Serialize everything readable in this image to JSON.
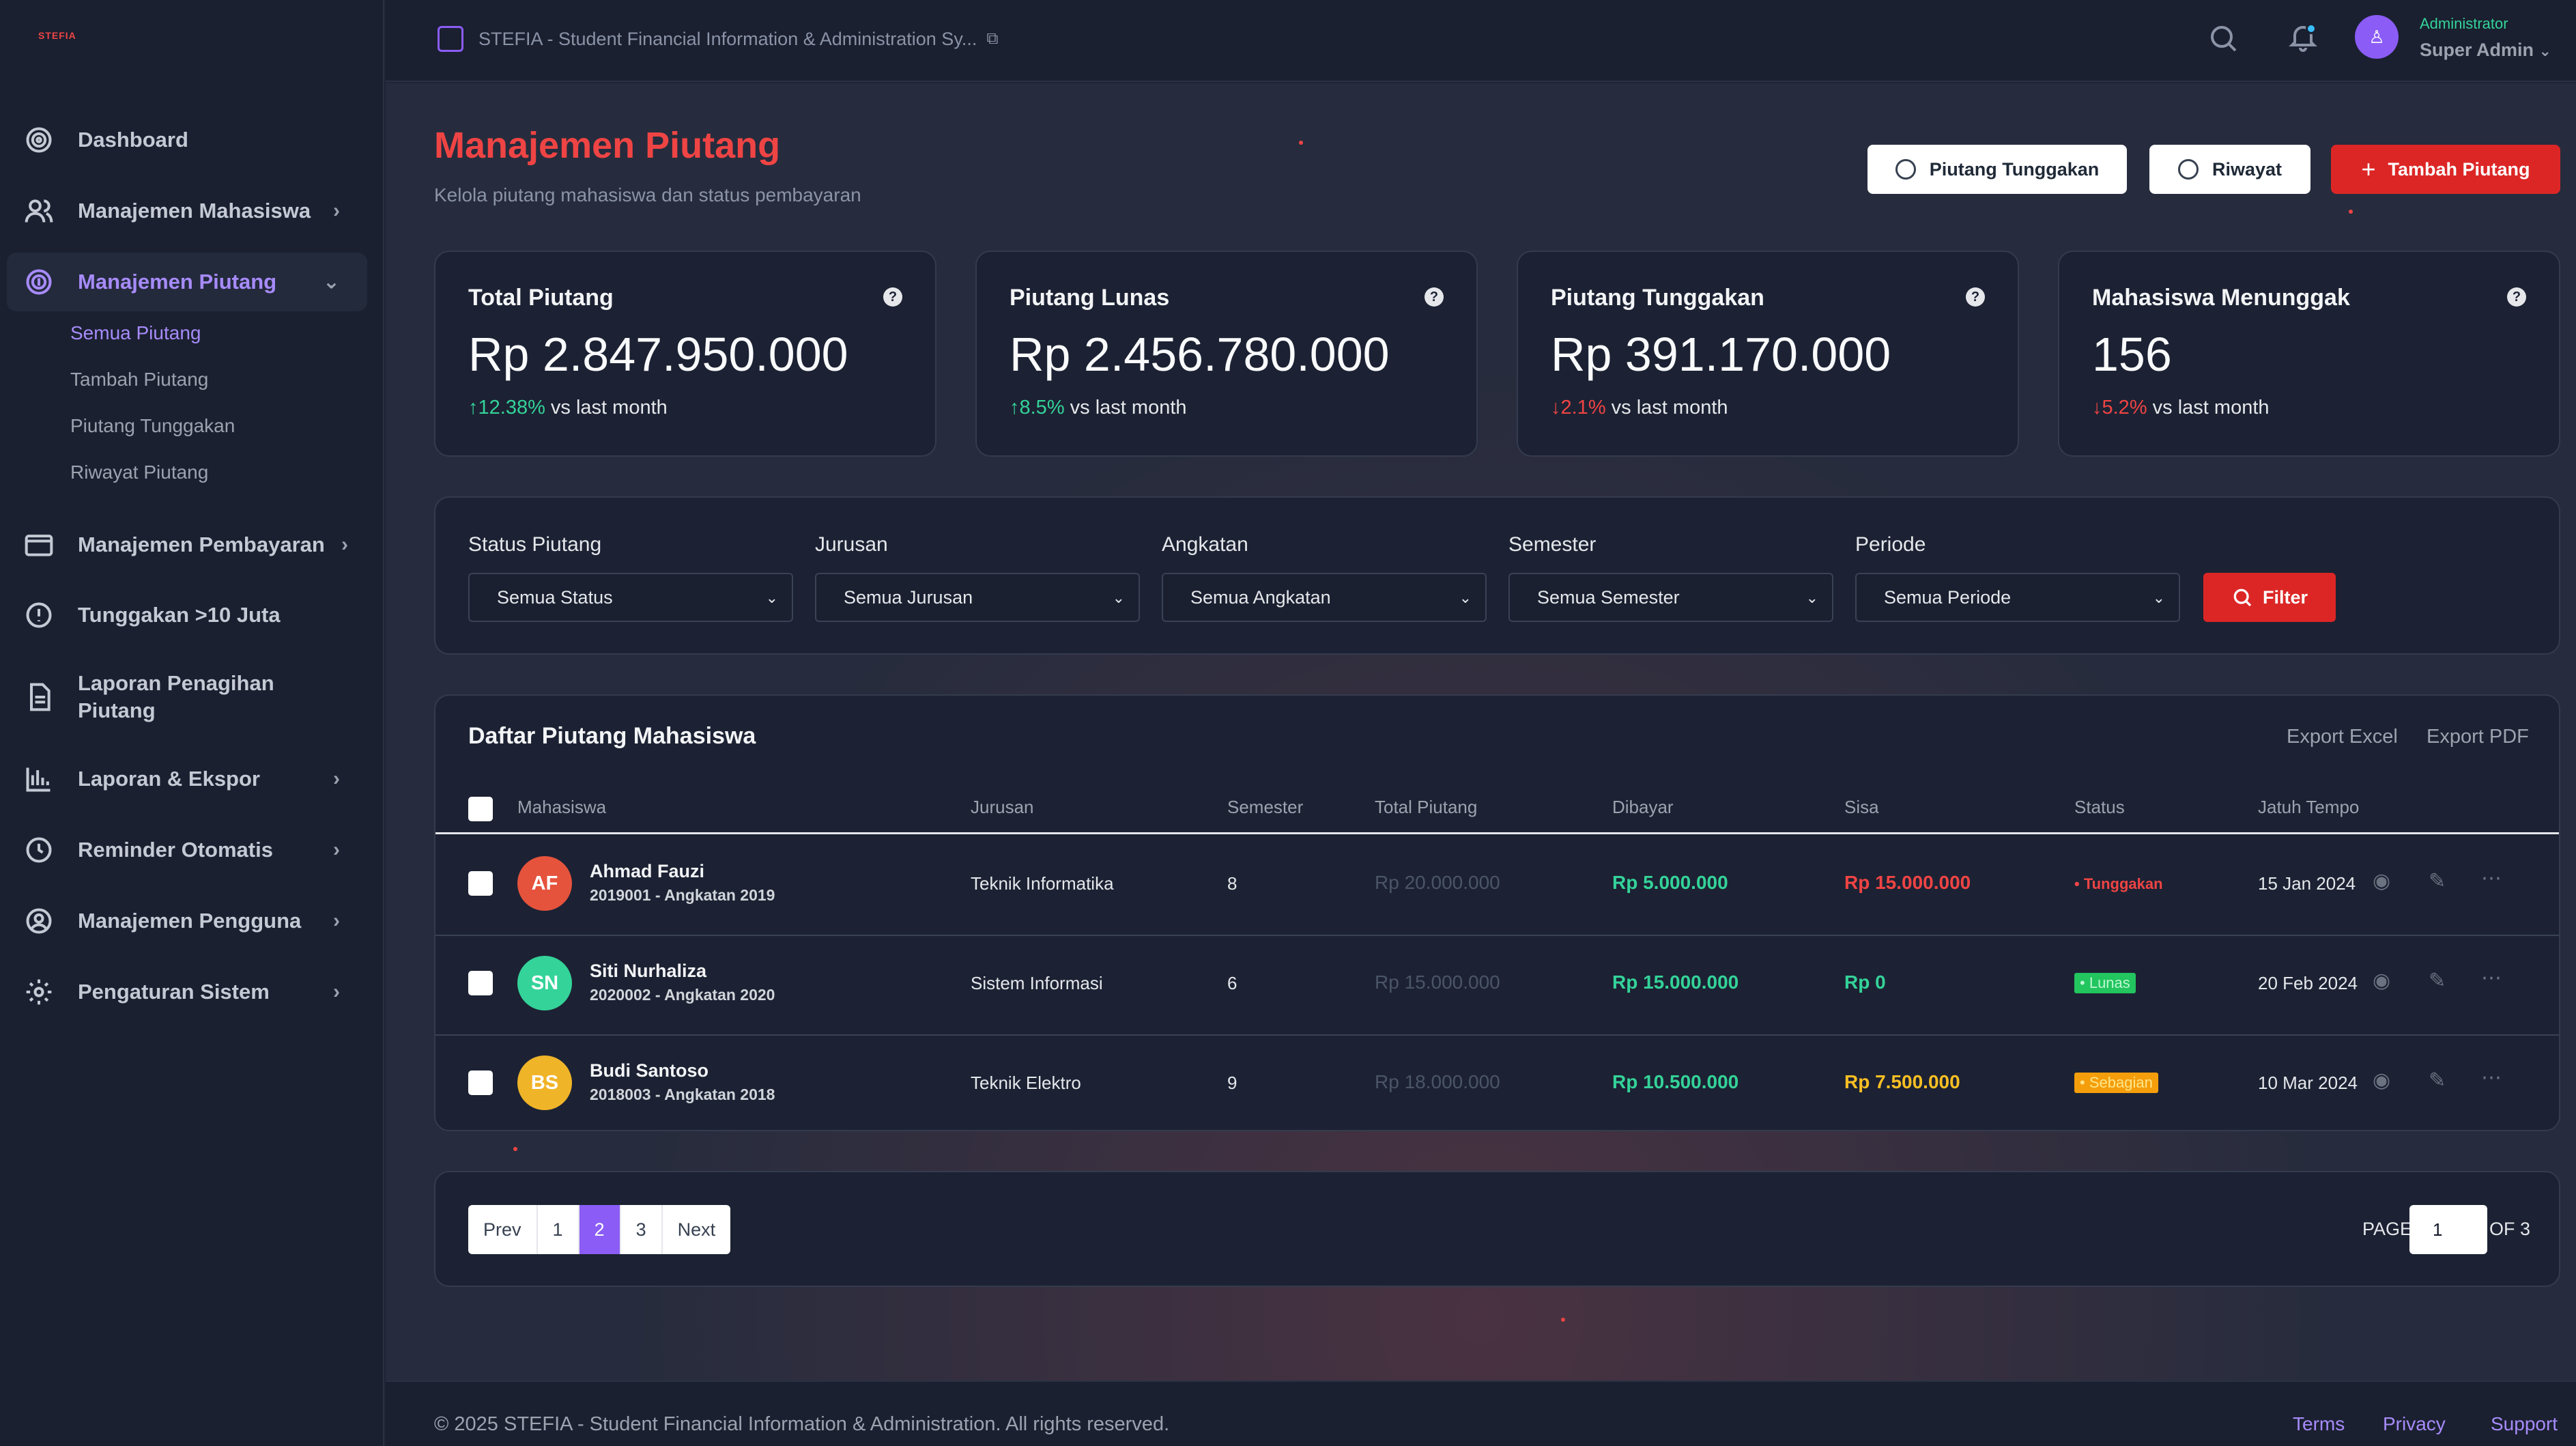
{
  "app": {
    "logo": "STEFIA",
    "title": "STEFIA - Student Financial Information & Administration Sy..."
  },
  "user": {
    "role": "Administrator",
    "name": "Super Admin"
  },
  "sidebar": {
    "items": [
      {
        "label": "Dashboard"
      },
      {
        "label": "Manajemen Mahasiswa"
      },
      {
        "label": "Manajemen Piutang"
      },
      {
        "label": "Manajemen Pembayaran"
      },
      {
        "label": "Tunggakan >10 Juta"
      },
      {
        "label": "Laporan Penagihan Piutang"
      },
      {
        "label": "Laporan & Ekspor"
      },
      {
        "label": "Reminder Otomatis"
      },
      {
        "label": "Manajemen Pengguna"
      },
      {
        "label": "Pengaturan Sistem"
      }
    ],
    "subitems": [
      "Semua Piutang",
      "Tambah Piutang",
      "Piutang Tunggakan",
      "Riwayat Piutang"
    ]
  },
  "page": {
    "title": "Manajemen Piutang",
    "subtitle": "Kelola piutang mahasiswa dan status pembayaran",
    "buttons": {
      "tunggakan": "Piutang Tunggakan",
      "riwayat": "Riwayat",
      "tambah": "Tambah Piutang"
    }
  },
  "stats": [
    {
      "label": "Total Piutang",
      "value": "Rp 2.847.950.000",
      "arrow": "↑",
      "change": "12.38%",
      "suffix": "vs last month"
    },
    {
      "label": "Piutang Lunas",
      "value": "Rp 2.456.780.000",
      "arrow": "↑",
      "change": "8.5%",
      "suffix": "vs last month"
    },
    {
      "label": "Piutang Tunggakan",
      "value": "Rp 391.170.000",
      "arrow": "↓",
      "change": "2.1%",
      "suffix": "vs last month"
    },
    {
      "label": "Mahasiswa Menunggak",
      "value": "156",
      "arrow": "↓",
      "change": "5.2%",
      "suffix": "vs last month"
    }
  ],
  "filters": {
    "status": {
      "label": "Status Piutang",
      "value": "Semua Status"
    },
    "jurusan": {
      "label": "Jurusan",
      "value": "Semua Jurusan"
    },
    "angkatan": {
      "label": "Angkatan",
      "value": "Semua Angkatan"
    },
    "semester": {
      "label": "Semester",
      "value": "Semua Semester"
    },
    "periode": {
      "label": "Periode",
      "value": "Semua Periode"
    },
    "button": "Filter"
  },
  "table": {
    "title": "Daftar Piutang Mahasiswa",
    "export_excel": "Export Excel",
    "export_pdf": "Export PDF",
    "columns": [
      "Mahasiswa",
      "Jurusan",
      "Semester",
      "Total Piutang",
      "Dibayar",
      "Sisa",
      "Status",
      "Jatuh Tempo"
    ],
    "rows": [
      {
        "initials": "AF",
        "color": "#e5533d",
        "name": "Ahmad Fauzi",
        "meta": "2019001 - Angkatan 2019",
        "jurusan": "Teknik Informatika",
        "semester": "8",
        "total": "Rp 20.000.000",
        "dibayar": "Rp 5.000.000",
        "sisa": "Rp 15.000.000",
        "status": "Tunggakan",
        "due": "15 Jan 2024"
      },
      {
        "initials": "SN",
        "color": "#34d399",
        "name": "Siti Nurhaliza",
        "meta": "2020002 - Angkatan 2020",
        "jurusan": "Sistem Informasi",
        "semester": "6",
        "total": "Rp 15.000.000",
        "dibayar": "Rp 15.000.000",
        "sisa": "Rp 0",
        "status": "Lunas",
        "due": "20 Feb 2024"
      },
      {
        "initials": "BS",
        "color": "#f0b429",
        "name": "Budi Santoso",
        "meta": "2018003 - Angkatan 2018",
        "jurusan": "Teknik Elektro",
        "semester": "9",
        "total": "Rp 18.000.000",
        "dibayar": "Rp 10.500.000",
        "sisa": "Rp 7.500.000",
        "status": "Sebagian",
        "due": "10 Mar 2024"
      }
    ]
  },
  "pagination": {
    "prev": "Prev",
    "pages": [
      "1",
      "2",
      "3"
    ],
    "next": "Next",
    "current": "2",
    "page_label": "PAGE",
    "page_value": "1",
    "of_label": "OF 3"
  },
  "footer": {
    "copyright": "© 2025 STEFIA - Student Financial Information & Administration. All rights reserved.",
    "terms": "Terms",
    "privacy": "Privacy",
    "support": "Support"
  },
  "colors": {
    "accent": "#8b5cf6",
    "danger": "#dc2626",
    "success": "#34d399",
    "warning": "#fbbf24"
  }
}
